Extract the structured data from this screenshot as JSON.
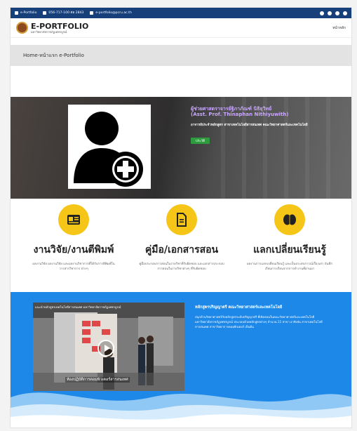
{
  "topbar": {
    "eportfolio_label": "e-Portfolio",
    "phone": "056-717-100 ต่อ 2843",
    "email": "e-portfolio@pcru.ac.th"
  },
  "header": {
    "logo_title": "E-PORTFOLIO",
    "logo_subtitle": "มหาวิทยาลัยราชภัฏเพชรบูรณ์",
    "nav_home": "หน้าหลัก"
  },
  "breadcrumb": {
    "text": "Home-หน้าแรก e-Portfolio"
  },
  "hero": {
    "name_th": "ผู้ช่วยศาสตราจารย์ฐิภาภัณฑ์ นิธิยุวิทย์",
    "name_en": "(Asst. Prof. Thinaphan Nithiyuwith)",
    "role": "อาจารย์ประจำหลักสูตร สาขาเทคโนโลยีสารสนเทศ คณะวิทยาศาสตร์และเทคโนโลยี",
    "history_button": "ประวัติ"
  },
  "features": [
    {
      "title": "งานวิจัย/งานตีพิมพ์",
      "desc": "ผลงานวิจัย ผลงานวิจัย และผลงานวิชาการที่ได้รับการตีพิมพ์ในวารสารวิชาการ ต่างๆ",
      "icon": "newspaper-icon"
    },
    {
      "title": "คู่มือ/เอกสารสอน",
      "desc": "คู่มือประกอบการสอนในรายวิชาที่รับผิดชอบ และเอกสารประกอบการสอนในรายวิชาต่างๆ ที่รับผิดชอบ",
      "icon": "document-icon"
    },
    {
      "title": "แลกเปลี่ยนเรียนรู้",
      "desc": "ผลงานการแลกเปลี่ยนเรียนรู้ และเป็นประสบการณ์เรื่องเล่า บันทึกเรียนการเรียนจากการทำงานที่ผ่านมา",
      "icon": "brain-icon"
    }
  ],
  "program": {
    "video_title": "แนะนำหลักสูตรเทคโนโลยีสารสนเทศ มหาวิทยาลัยราชภัฏเพชรบูรณ์",
    "video_caption": "ห้องปฏิบัติการคอมพิวเตอร์สารสนเทศ",
    "title": "หลักสูตรปริญญาตรี คณะวิทยาศาสตร์และเทคโนโลยี",
    "desc": "สนุกด้านวิทยาศาสตร์กับหลักสูตรระดับปริญญาตรี ที่เปิดสอนในคณะวิทยาศาสตร์และเทคโนโลยี มหาวิทยาลัยราชภัฏเพชรบูรณ์ ประกอบด้วยหลักสูตรต่างๆ จำนวน 11 สาขา อาทิเช่น สาขาเทคโนโลยีสารสนเทศ สาขาวิทยาการคอมพิวเตอร์ เป็นต้น"
  },
  "colors": {
    "topbar": "#173f7a",
    "accent_yellow": "#f5c518",
    "blue_section": "#1e88e8",
    "name_purple": "#c9a6ff",
    "button_green": "#2e9b3f"
  }
}
